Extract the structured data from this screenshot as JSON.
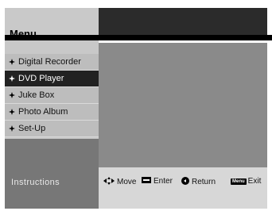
{
  "menu": {
    "title": "Menu",
    "items": [
      {
        "label": "Digital Recorder",
        "active": false
      },
      {
        "label": "DVD Player",
        "active": true
      },
      {
        "label": "Juke Box",
        "active": false
      },
      {
        "label": "Photo Album",
        "active": false
      },
      {
        "label": "Set-Up",
        "active": false
      }
    ]
  },
  "instructions": {
    "label": "Instructions",
    "move": "Move",
    "enter": "Enter",
    "return": "Return",
    "menu_badge": "Menu",
    "exit": "Exit"
  },
  "colors": {
    "active_bg": "#222222",
    "active_text": "#ffffff",
    "menu_bg": "#bdbdbd"
  }
}
